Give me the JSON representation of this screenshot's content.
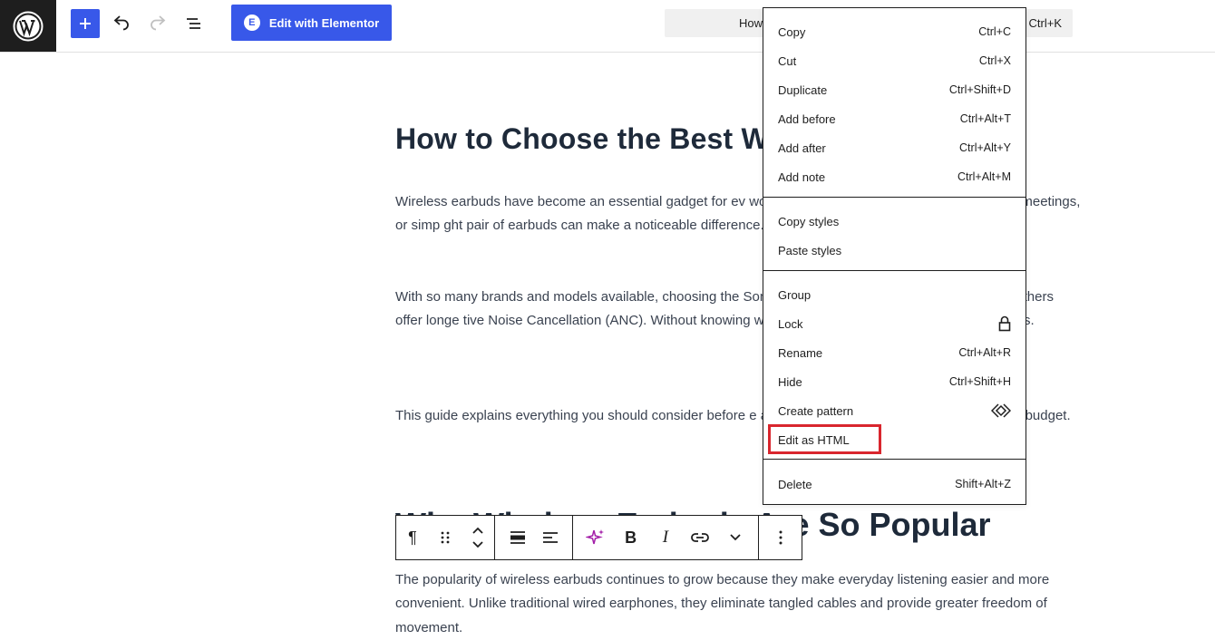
{
  "toolbar": {
    "elementor_label": "Edit with Elementor",
    "command_text": "How",
    "command_shortcut": "Ctrl+K"
  },
  "post": {
    "title": "How to Choose the Best Wir",
    "paragraphs": [
      "Wireless earbuds have become an essential gadget for ev                                                            work, exercising at the gym, attending online meetings, or simp                                                              ght pair of earbuds can make a noticeable difference.",
      "With so many brands and models available, choosing the                                                           Some focus on premium sound quality, while others offer longe                                                           tive Noise Cancellation (ANC). Without knowing what to look                                                          that don't meet your expectations.",
      "This guide explains everything you should consider before                                                          e a smart purchase that suits your needs and budget."
    ],
    "section_title": "Why Wireless Earbuds Are So Popular",
    "section_paragraph": "The popularity of wireless earbuds continues to grow because they make everyday listening easier and more convenient. Unlike traditional wired earphones, they eliminate tangled cables and provide greater freedom of movement."
  },
  "context_menu": {
    "group1": [
      {
        "label": "Copy",
        "shortcut": "Ctrl+C"
      },
      {
        "label": "Cut",
        "shortcut": "Ctrl+X"
      },
      {
        "label": "Duplicate",
        "shortcut": "Ctrl+Shift+D"
      },
      {
        "label": "Add before",
        "shortcut": "Ctrl+Alt+T"
      },
      {
        "label": "Add after",
        "shortcut": "Ctrl+Alt+Y"
      },
      {
        "label": "Add note",
        "shortcut": "Ctrl+Alt+M"
      }
    ],
    "group2": [
      {
        "label": "Copy styles"
      },
      {
        "label": "Paste styles"
      }
    ],
    "group3": [
      {
        "label": "Group"
      },
      {
        "label": "Lock",
        "icon": "lock-icon"
      },
      {
        "label": "Rename",
        "shortcut": "Ctrl+Alt+R"
      },
      {
        "label": "Hide",
        "shortcut": "Ctrl+Shift+H"
      },
      {
        "label": "Create pattern",
        "icon": "pattern-icon"
      },
      {
        "label": "Edit as HTML"
      }
    ],
    "group4": [
      {
        "label": "Delete",
        "shortcut": "Shift+Alt+Z"
      }
    ]
  },
  "colors": {
    "accent": "#3858e9",
    "highlight": "#d9262e",
    "heading": "#1e2a3a",
    "body_text": "#3a4250"
  }
}
